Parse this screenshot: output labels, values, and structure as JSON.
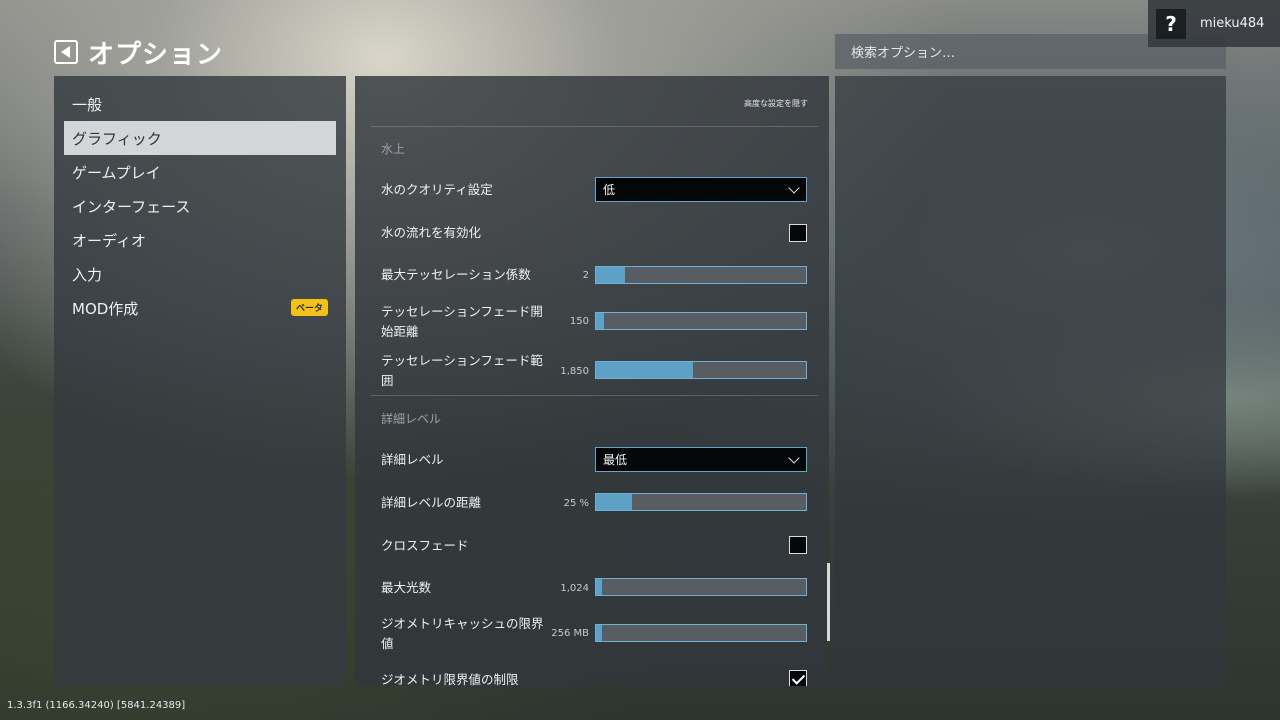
{
  "header": {
    "title": "オプション"
  },
  "search": {
    "placeholder": "検索オプション…"
  },
  "user": {
    "help_label": "?",
    "name": "mieku484"
  },
  "sidebar": {
    "items": [
      {
        "label": "一般"
      },
      {
        "label": "グラフィック",
        "active": true
      },
      {
        "label": "ゲームプレイ"
      },
      {
        "label": "インターフェース"
      },
      {
        "label": "オーディオ"
      },
      {
        "label": "入力"
      },
      {
        "label": "MOD作成",
        "badge": "ベータ"
      }
    ]
  },
  "main": {
    "hide_advanced_label": "高度な設定を隠す",
    "water_section": {
      "title": "水上",
      "water_quality": {
        "label": "水のクオリティ設定",
        "value": "低"
      },
      "water_flow": {
        "label": "水の流れを有効化",
        "checked": false
      },
      "max_tessellation": {
        "label": "最大テッセレーション係数",
        "value": "2",
        "fill": 0.14
      },
      "tess_fade_start": {
        "label": "テッセレーションフェード開始距離",
        "value": "150",
        "fill": 0.04
      },
      "tess_fade_range": {
        "label": "テッセレーションフェード範囲",
        "value": "1,850",
        "fill": 0.46
      }
    },
    "lod_section": {
      "title": "詳細レベル",
      "lod_level": {
        "label": "詳細レベル",
        "value": "最低"
      },
      "lod_distance": {
        "label": "詳細レベルの距離",
        "value": "25 %",
        "fill": 0.17
      },
      "crossfade": {
        "label": "クロスフェード",
        "checked": false
      },
      "max_lights": {
        "label": "最大光数",
        "value": "1,024",
        "fill": 0.03
      },
      "geometry_cache": {
        "label": "ジオメトリキャッシュの限界値",
        "value": "256 MB",
        "fill": 0.03
      },
      "geometry_limit": {
        "label": "ジオメトリ限界値の制限",
        "checked": true
      }
    }
  },
  "footer": {
    "version": "1.3.3f1 (1166.34240) [5841.24389]"
  },
  "colors": {
    "accent": "#5da1c7",
    "badge": "#f2c21b"
  }
}
